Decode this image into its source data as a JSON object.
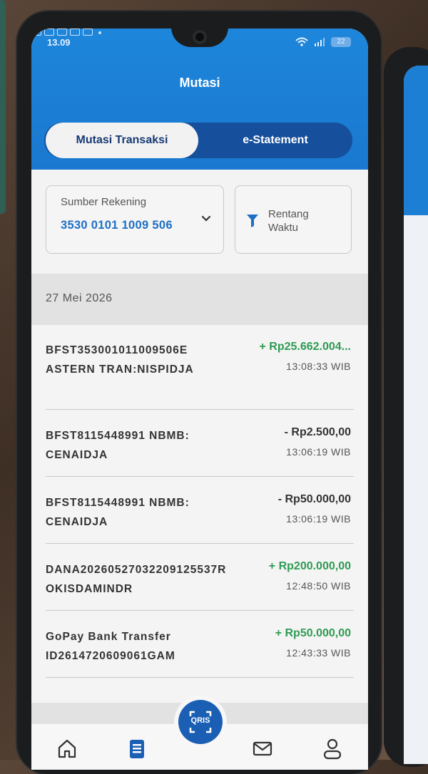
{
  "status_bar": {
    "time": "13.09",
    "battery": "22"
  },
  "header": {
    "title": "Mutasi"
  },
  "tabs": [
    {
      "label": "Mutasi Transaksi",
      "active": true
    },
    {
      "label": "e-Statement",
      "active": false
    }
  ],
  "account": {
    "label": "Sumber Rekening",
    "number": "3530 0101 1009 506"
  },
  "range": {
    "label": "Rentang Waktu"
  },
  "date_group": "27 Mei 2026",
  "transactions": [
    {
      "description": "BFST353001011009506EASTERN TRAN:NISPIDJA",
      "amount": "+ Rp25.662.004...",
      "time": "13:08:33 WIB",
      "direction": "in"
    },
    {
      "description": "BFST8115448991 NBMB:CENAIDJA",
      "amount": "- Rp2.500,00",
      "time": "13:06:19 WIB",
      "direction": "out"
    },
    {
      "description": "BFST8115448991 NBMB:CENAIDJA",
      "amount": "- Rp50.000,00",
      "time": "13:06:19 WIB",
      "direction": "out"
    },
    {
      "description": "DANA20260527032209125537ROKISDAMINDR",
      "amount": "+ Rp200.000,00",
      "time": "12:48:50 WIB",
      "direction": "in"
    },
    {
      "description": "GoPay Bank Transfer ID2614720609061GAM",
      "amount": "+ Rp50.000,00",
      "time": "12:43:33 WIB",
      "direction": "in"
    }
  ],
  "bottom_nav": {
    "items": [
      "home-icon",
      "mutasi-icon",
      "qris-icon",
      "mail-icon",
      "profile-icon"
    ],
    "qris_label": "QRIS"
  },
  "colors": {
    "primary": "#1d86db",
    "tab_bg": "#164f9b",
    "credit": "#2e9b52",
    "account_number": "#1e6fc4"
  }
}
